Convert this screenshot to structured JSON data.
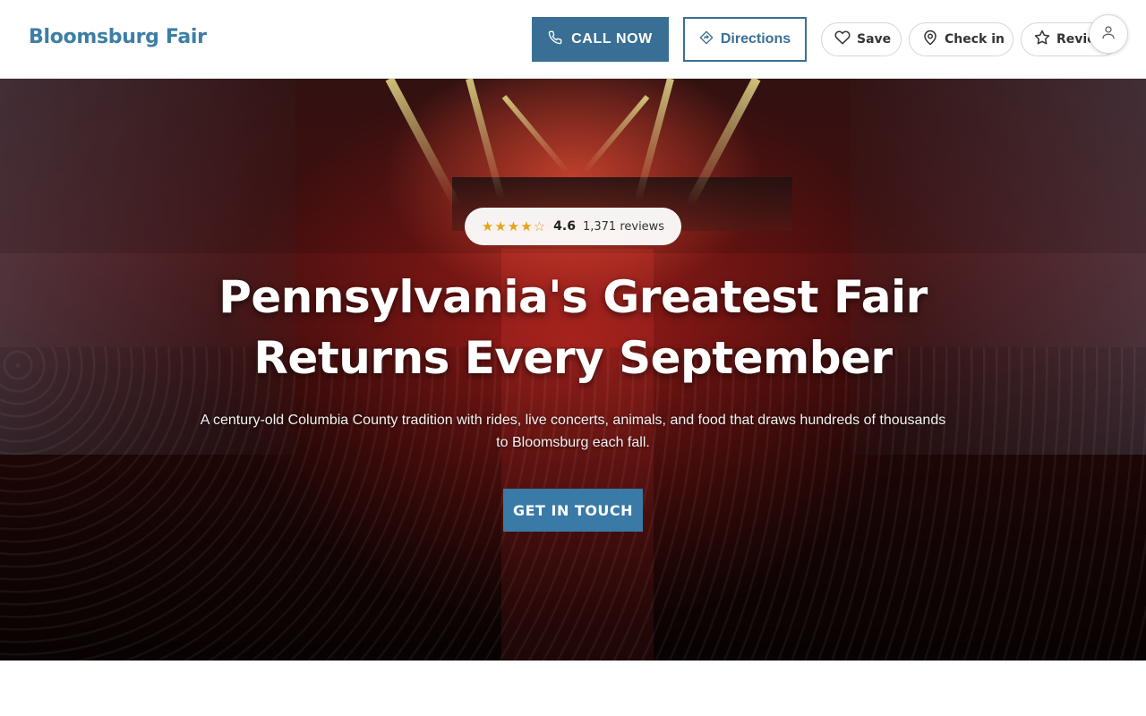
{
  "header": {
    "brand": "Bloomsburg Fair",
    "call_label": "CALL NOW",
    "directions_label": "Directions",
    "save_label": "Save",
    "checkin_label": "Check in",
    "review_label": "Review",
    "icons": {
      "call": "phone-icon",
      "directions": "directions-icon",
      "save": "heart-icon",
      "checkin": "map-pin-icon",
      "review": "star-icon",
      "avatar": "user-icon"
    },
    "colors": {
      "brand": "#3d7ea6",
      "primary": "#3a6f95"
    }
  },
  "hero": {
    "rating": {
      "stars_display": "★★★★☆",
      "value": "4.6",
      "reviews": "1,371 reviews",
      "star_color": "#e8a419"
    },
    "title": "Pennsylvania's Greatest Fair Returns Every September",
    "subtitle": "A century-old Columbia County tradition with rides, live concerts, animals, and food that draws hundreds of thousands to Bloomsburg each fall.",
    "cta_label": "GET IN TOUCH",
    "cta_color": "#3a7aa6"
  }
}
